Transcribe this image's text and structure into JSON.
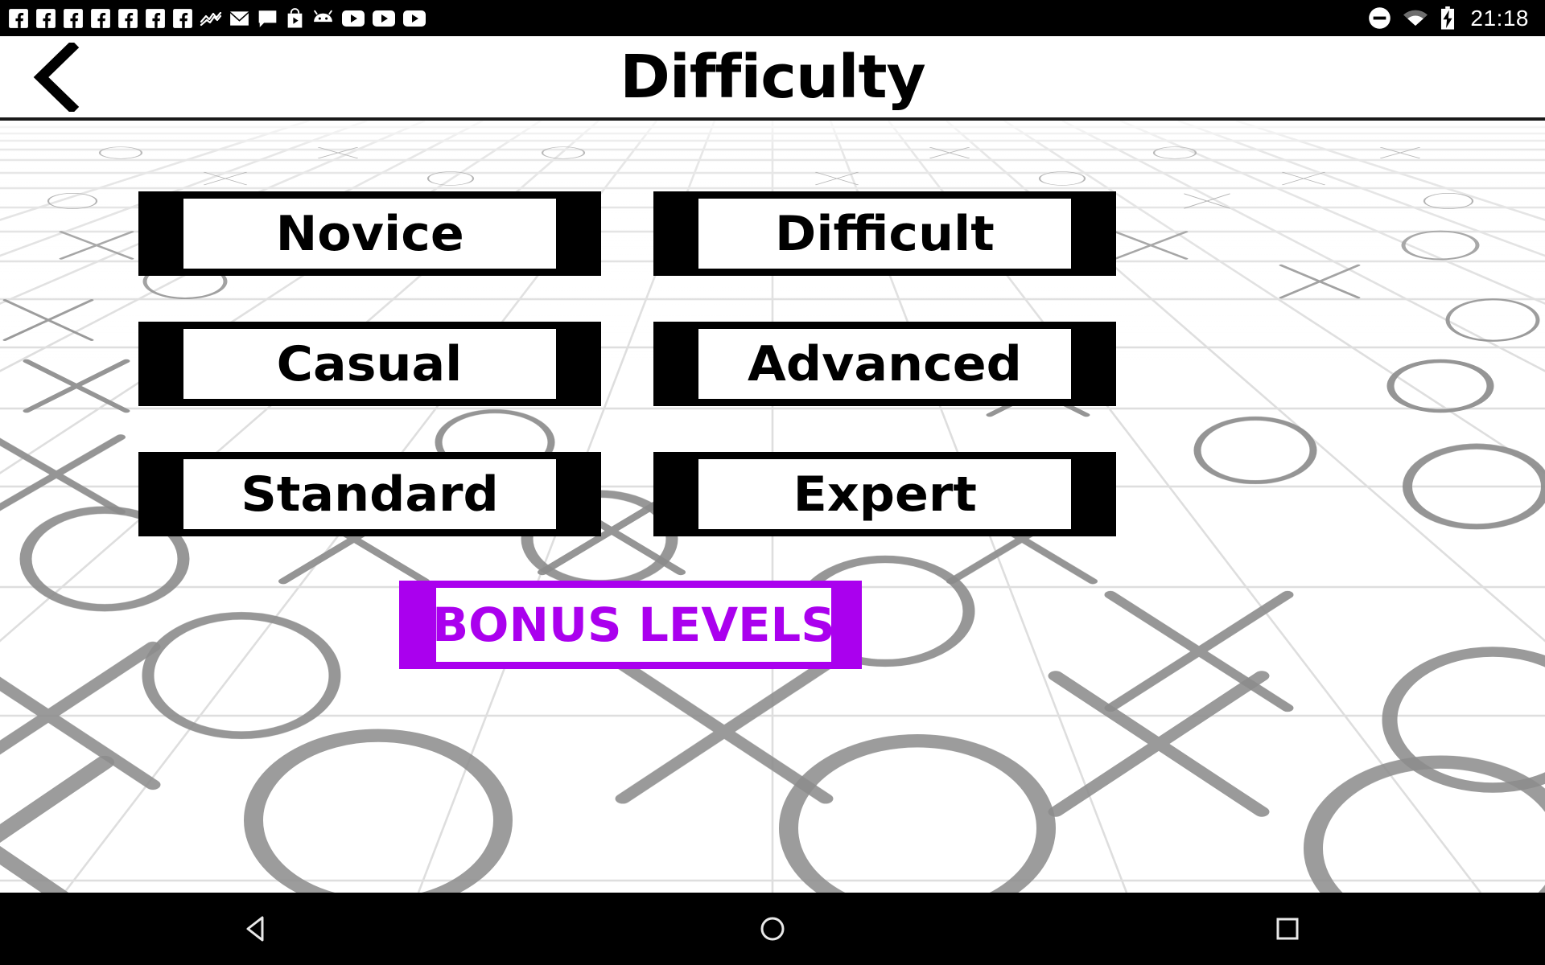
{
  "statusbar": {
    "left_icons": [
      {
        "name": "facebook-icon"
      },
      {
        "name": "facebook-icon"
      },
      {
        "name": "facebook-icon"
      },
      {
        "name": "facebook-icon"
      },
      {
        "name": "facebook-icon"
      },
      {
        "name": "facebook-icon"
      },
      {
        "name": "facebook-icon"
      },
      {
        "name": "trending-chart-icon"
      },
      {
        "name": "envelope-mail-icon"
      },
      {
        "name": "chat-bubble-icon"
      },
      {
        "name": "play-store-bag-icon"
      },
      {
        "name": "android-head-icon"
      },
      {
        "name": "youtube-icon"
      },
      {
        "name": "youtube-icon"
      },
      {
        "name": "youtube-icon"
      }
    ],
    "right_icons": [
      {
        "name": "do-not-disturb-icon"
      },
      {
        "name": "wifi-icon"
      },
      {
        "name": "battery-charging-icon"
      }
    ],
    "clock": "21:18"
  },
  "header": {
    "back_label": "Back",
    "title": "Difficulty"
  },
  "difficulty": {
    "left_column": [
      {
        "label": "Novice"
      },
      {
        "label": "Casual"
      },
      {
        "label": "Standard"
      }
    ],
    "right_column": [
      {
        "label": "Difficult"
      },
      {
        "label": "Advanced"
      },
      {
        "label": "Expert"
      }
    ]
  },
  "bonus": {
    "label": "BONUS LEVELS"
  },
  "navbar": {
    "back_label": "Back",
    "home_label": "Home",
    "recents_label": "Recent apps"
  },
  "colors": {
    "button_frame": "#000000",
    "button_accent": "#808080",
    "button_face": "#ffffff",
    "bonus_frame": "#aa00ee",
    "bonus_accent": "#cc66f5",
    "bonus_text": "#aa00ee",
    "statusbar_bg": "#000000",
    "background": "#ffffff",
    "grid_line": "#d8d8d8",
    "mark_gray": "#8c8c8c"
  }
}
